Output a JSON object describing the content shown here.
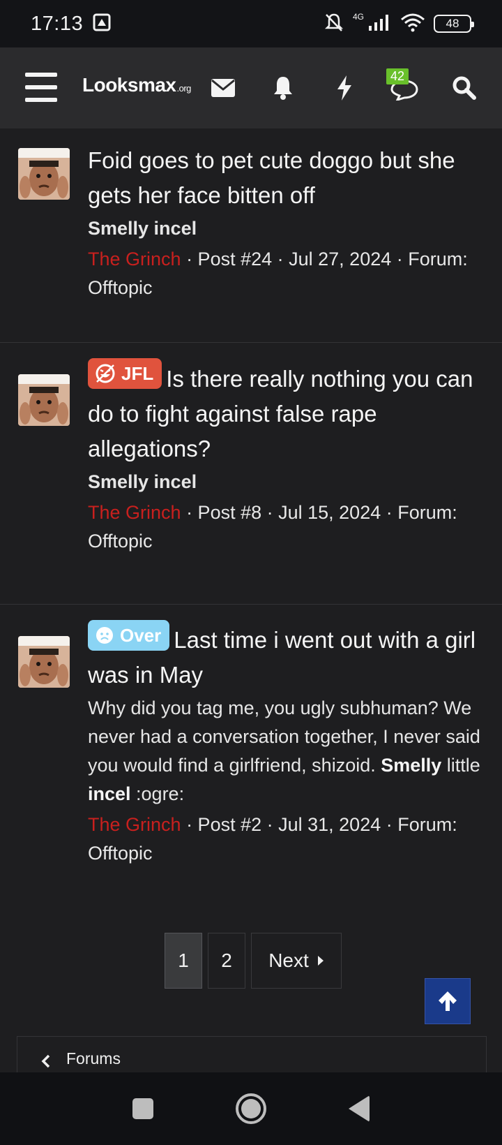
{
  "status_bar": {
    "time": "17:13",
    "network": "4G",
    "battery": "48",
    "icons": [
      "screenshot-icon",
      "bell-muted-icon",
      "signal-icon",
      "wifi-icon",
      "battery-icon"
    ]
  },
  "header": {
    "logo_main": "Looksmax",
    "logo_suffix": ".org",
    "notification_count": "42",
    "icons": [
      "menu-icon",
      "envelope-icon",
      "bell-icon",
      "lightning-icon",
      "comments-icon",
      "search-icon"
    ]
  },
  "posts": [
    {
      "prefix": "",
      "title": "Foid goes to pet cute doggo but she gets her face bitten off",
      "snippet": "Smelly incel",
      "author": "The Grinch",
      "meta": " · Post #24 · Jul 27, 2024 · Forum: Offtopic"
    },
    {
      "prefix": "JFL",
      "title": "Is there really nothing you can do to fight against false rape allegations?",
      "snippet": "Smelly incel",
      "author": "The Grinch",
      "meta": " · Post #8 · Jul 15, 2024 · Forum: Offtopic"
    },
    {
      "prefix": "Over",
      "title": "Last time i went out with a girl was in May",
      "snippet_before": "Why did you tag me, you ugly subhuman? We never had a conversation together, I never said you would find a girlfriend, shizoid. ",
      "snippet_bold1": "Smelly",
      "snippet_mid": " little ",
      "snippet_bold2": "incel",
      "snippet_after": " :ogre:",
      "author": "The Grinch",
      "meta": " · Post #2 · Jul 31, 2024 · Forum: Offtopic"
    }
  ],
  "pagination": {
    "pages": [
      "1",
      "2"
    ],
    "current": "1",
    "next_label": "Next"
  },
  "breadcrumb": {
    "label": "Forums"
  },
  "colors": {
    "author": "#c8201e",
    "prefix_jfl": "#e0533d",
    "prefix_over": "#8ad4f4",
    "badge": "#69c02b",
    "to_top": "#1a3a8a"
  }
}
